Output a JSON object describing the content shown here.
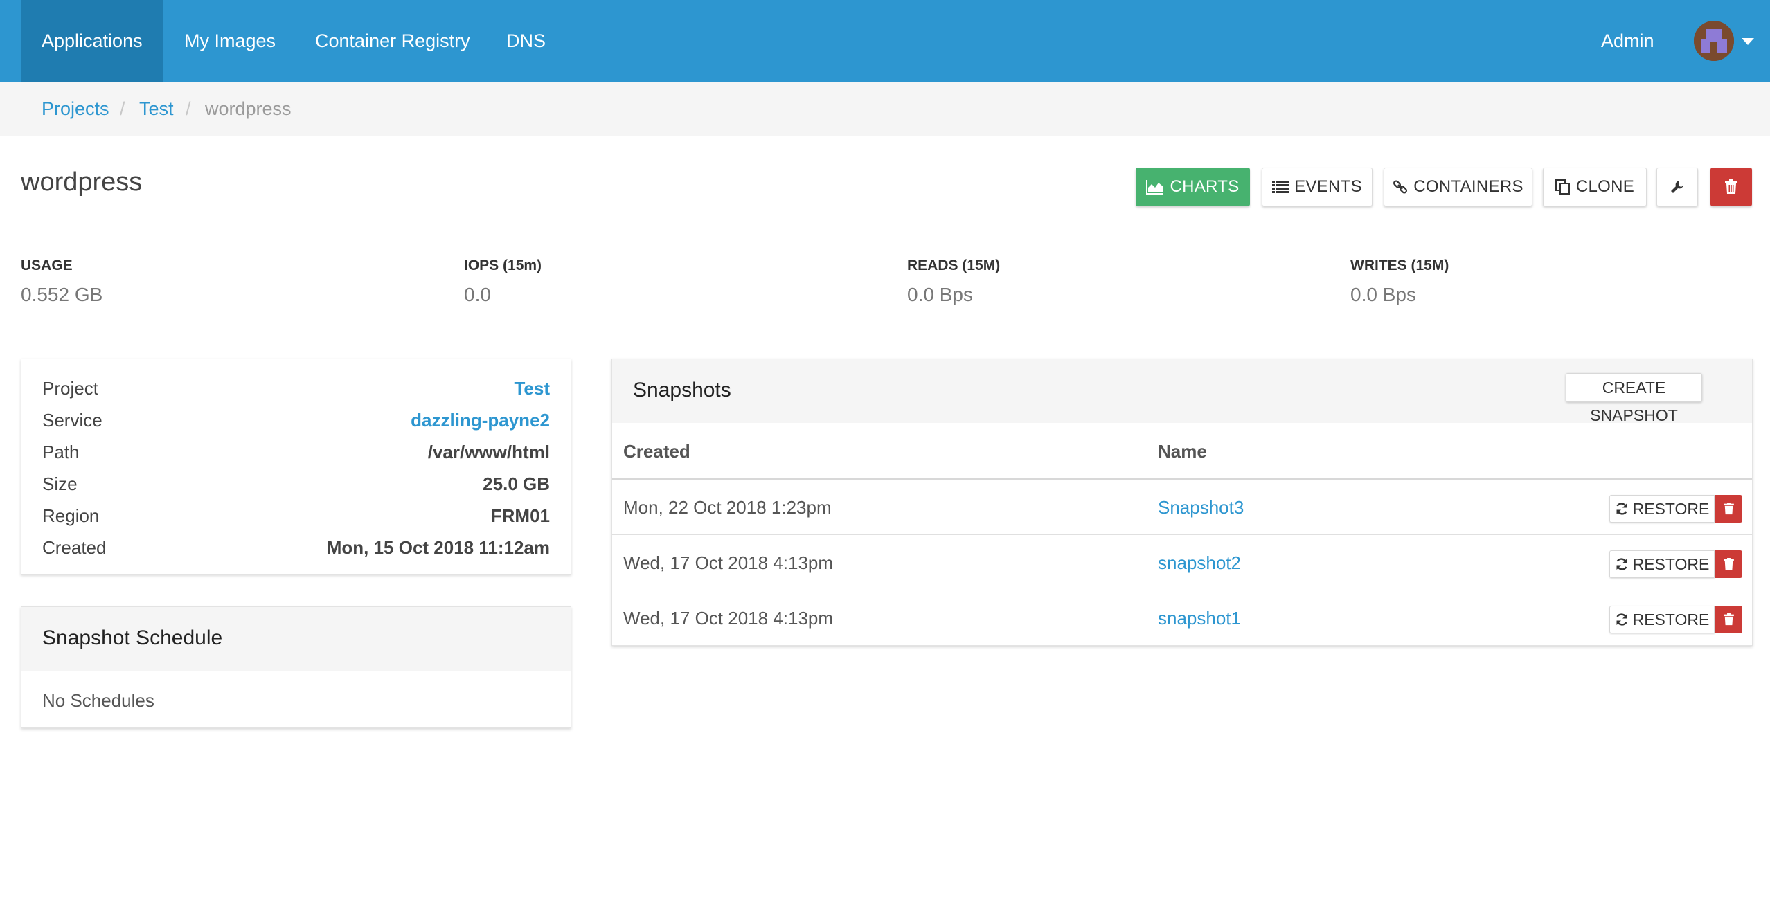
{
  "nav": {
    "items": [
      {
        "label": "Applications",
        "active": true
      },
      {
        "label": "My Images",
        "active": false
      },
      {
        "label": "Container Registry",
        "active": false
      },
      {
        "label": "DNS",
        "active": false
      }
    ],
    "user_label": "Admin",
    "avatar_icon": "user-avatar-icon",
    "colors": {
      "bar": "#2d96d0",
      "active": "#1f7cb0"
    }
  },
  "breadcrumb": {
    "items": [
      "Projects",
      "Test",
      "wordpress"
    ],
    "separator": "/"
  },
  "page": {
    "title": "wordpress"
  },
  "toolbar": {
    "charts": "CHARTS",
    "events": "EVENTS",
    "containers": "CONTAINERS",
    "clone": "CLONE",
    "settings_icon": "wrench-icon",
    "delete_icon": "trash-icon",
    "colors": {
      "charts": "#47b26f",
      "delete": "#cc3a36"
    }
  },
  "stats": [
    {
      "label": "USAGE",
      "value": "0.552 GB"
    },
    {
      "label": "IOPS (15m)",
      "value": "0.0"
    },
    {
      "label": "READS (15M)",
      "value": "0.0 Bps"
    },
    {
      "label": "WRITES (15M)",
      "value": "0.0 Bps"
    }
  ],
  "info": [
    {
      "key": "Project",
      "value": "Test",
      "link": true
    },
    {
      "key": "Service",
      "value": "dazzling-payne2",
      "link": true
    },
    {
      "key": "Path",
      "value": "/var/www/html",
      "link": false
    },
    {
      "key": "Size",
      "value": "25.0 GB",
      "link": false
    },
    {
      "key": "Region",
      "value": "FRM01",
      "link": false
    },
    {
      "key": "Created",
      "value": "Mon, 15 Oct 2018 11:12am",
      "link": false
    }
  ],
  "schedule": {
    "title": "Snapshot Schedule",
    "empty_text": "No Schedules"
  },
  "snapshots": {
    "title": "Snapshots",
    "create_label": "CREATE SNAPSHOT",
    "columns": [
      "Created",
      "Name"
    ],
    "restore_label": "RESTORE",
    "rows": [
      {
        "created": "Mon, 22 Oct 2018 1:23pm",
        "name": "Snapshot3"
      },
      {
        "created": "Wed, 17 Oct 2018 4:13pm",
        "name": "snapshot2"
      },
      {
        "created": "Wed, 17 Oct 2018 4:13pm",
        "name": "snapshot1"
      }
    ]
  }
}
